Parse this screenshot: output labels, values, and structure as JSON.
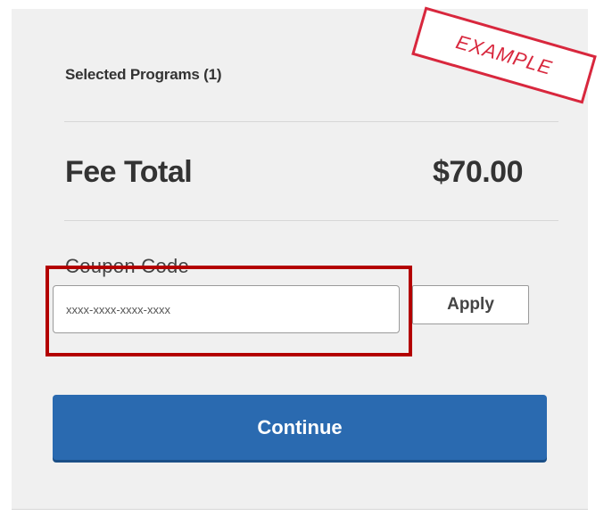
{
  "summary": {
    "selected_programs_label": "Selected Programs (1)",
    "fee_total_label": "Fee Total",
    "fee_total_amount": "$70.00"
  },
  "coupon": {
    "label": "Coupon Code",
    "placeholder": "xxxx-xxxx-xxxx-xxxx",
    "apply_label": "Apply"
  },
  "actions": {
    "continue_label": "Continue"
  },
  "stamp": {
    "text": "EXAMPLE"
  },
  "colors": {
    "panel_background": "#f0f0f0",
    "continue_button": "#2a6ab0",
    "highlight_border": "#b30000",
    "stamp_red": "#d8273d"
  }
}
